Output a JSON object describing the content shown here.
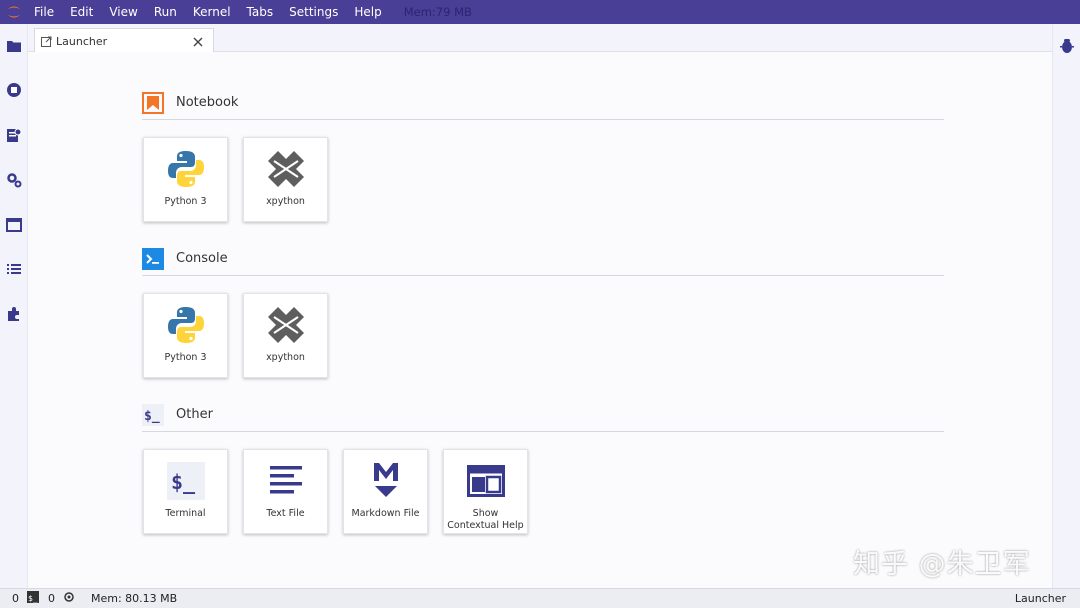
{
  "menubar": {
    "items": [
      "File",
      "Edit",
      "View",
      "Run",
      "Kernel",
      "Tabs",
      "Settings",
      "Help"
    ],
    "memory": "Mem:79 MB"
  },
  "tabs": [
    {
      "label": "Launcher"
    }
  ],
  "launcher": {
    "sections": [
      {
        "title": "Notebook",
        "items": [
          {
            "label": "Python 3",
            "icon": "python-logo-icon"
          },
          {
            "label": "xpython",
            "icon": "xpython-logo-icon"
          }
        ]
      },
      {
        "title": "Console",
        "items": [
          {
            "label": "Python 3",
            "icon": "python-logo-icon"
          },
          {
            "label": "xpython",
            "icon": "xpython-logo-icon"
          }
        ]
      },
      {
        "title": "Other",
        "items": [
          {
            "label": "Terminal",
            "icon": "terminal-icon"
          },
          {
            "label": "Text File",
            "icon": "text-file-icon"
          },
          {
            "label": "Markdown File",
            "icon": "markdown-icon"
          },
          {
            "label": "Show Contextual Help",
            "icon": "contextual-help-icon"
          }
        ]
      }
    ]
  },
  "statusbar": {
    "terminals_count": "0",
    "kernels_count": "0",
    "memory": "Mem: 80.13 MB",
    "mode": "Launcher"
  },
  "watermark": "知乎 @朱卫军",
  "colors": {
    "menubar": "#4a3f96",
    "accent": "#3f51b5",
    "notebook_orange": "#f37626",
    "console_blue": "#1e88e5"
  }
}
